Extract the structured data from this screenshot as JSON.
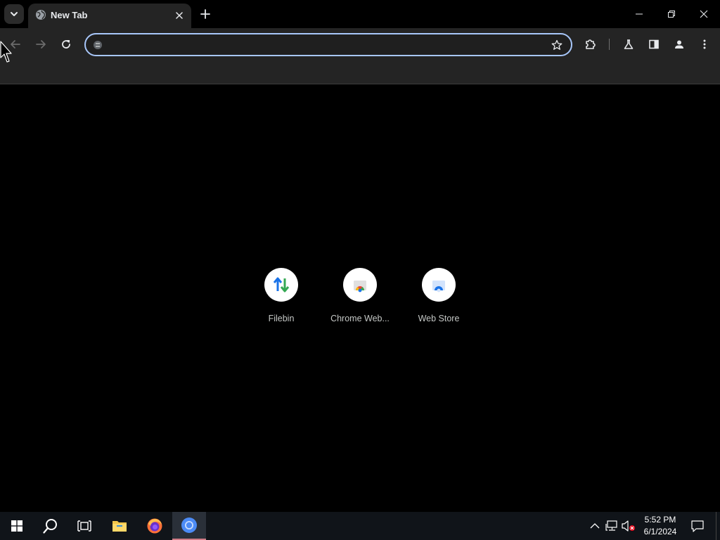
{
  "browser": {
    "tab": {
      "title": "New Tab",
      "favicon": "globe-icon"
    },
    "window_controls": [
      "minimize-icon",
      "restore-icon",
      "close-icon"
    ],
    "omnibox": {
      "value": "",
      "placeholder": "",
      "accent_color": "#a8c7fa"
    }
  },
  "shortcuts": [
    {
      "label": "Filebin",
      "icon": "up-down-arrows-icon"
    },
    {
      "label": "Chrome Web...",
      "icon": "chrome-web-store-icon"
    },
    {
      "label": "Web Store",
      "icon": "web-store-icon"
    }
  ],
  "taskbar": {
    "apps": [
      "windows-start-icon",
      "search-icon",
      "task-view-icon",
      "file-explorer-icon",
      "firefox-icon",
      "chrome-icon"
    ],
    "clock": {
      "time": "5:52 PM",
      "date": "6/1/2024"
    }
  }
}
